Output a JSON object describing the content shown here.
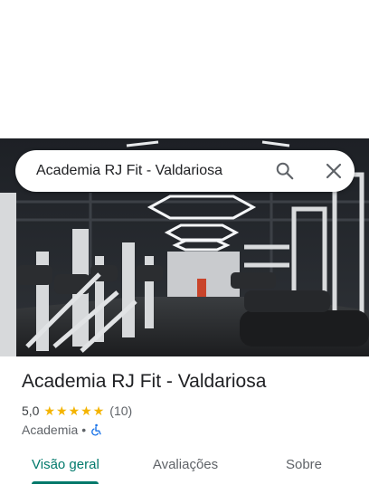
{
  "search": {
    "query": "Academia RJ Fit - Valdariosa"
  },
  "place": {
    "name": "Academia RJ Fit - Valdariosa",
    "rating": "5,0",
    "stars": 5,
    "reviews": "(10)",
    "category": "Academia",
    "separator": "•",
    "accessibility_icon": "wheelchair-accessible-icon"
  },
  "tabs": [
    {
      "label": "Visão geral",
      "active": true
    },
    {
      "label": "Avaliações",
      "active": false
    },
    {
      "label": "Sobre",
      "active": false
    }
  ],
  "colors": {
    "accent": "#00796b",
    "star": "#f4b400",
    "accessibility": "#1a73e8"
  }
}
